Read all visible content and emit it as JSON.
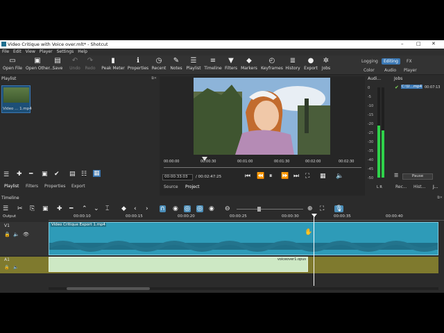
{
  "window": {
    "title": "Video Critique with Voice over.mlt* - Shotcut",
    "controls": [
      "–",
      "□",
      "✕"
    ]
  },
  "menubar": [
    "File",
    "Edit",
    "View",
    "Player",
    "Settings",
    "Help"
  ],
  "toolbar": {
    "buttons": [
      {
        "label": "Open File",
        "icon": "folder-open-icon",
        "glyph": "▭",
        "enabled": true
      },
      {
        "label": "Open Other...",
        "icon": "open-other-icon",
        "glyph": "▣",
        "enabled": true
      },
      {
        "label": "Save",
        "icon": "save-icon",
        "glyph": "▤",
        "enabled": true
      },
      {
        "label": "Undo",
        "icon": "undo-icon",
        "glyph": "↶",
        "enabled": false
      },
      {
        "label": "Redo",
        "icon": "redo-icon",
        "glyph": "↷",
        "enabled": false
      },
      {
        "label": "Peak Meter",
        "icon": "peak-meter-icon",
        "glyph": "▮",
        "enabled": true
      },
      {
        "label": "Properties",
        "icon": "properties-icon",
        "glyph": "ℹ",
        "enabled": true
      },
      {
        "label": "Recent",
        "icon": "recent-icon",
        "glyph": "◷",
        "enabled": true
      },
      {
        "label": "Notes",
        "icon": "notes-icon",
        "glyph": "✎",
        "enabled": true
      },
      {
        "label": "Playlist",
        "icon": "playlist-icon",
        "glyph": "☰",
        "enabled": true
      },
      {
        "label": "Timeline",
        "icon": "timeline-icon",
        "glyph": "≡",
        "enabled": true
      },
      {
        "label": "Filters",
        "icon": "filters-icon",
        "glyph": "▼",
        "enabled": true
      },
      {
        "label": "Markers",
        "icon": "markers-icon",
        "glyph": "◆",
        "enabled": true
      },
      {
        "label": "Keyframes",
        "icon": "keyframes-icon",
        "glyph": "◴",
        "enabled": true
      },
      {
        "label": "History",
        "icon": "history-icon",
        "glyph": "≣",
        "enabled": true
      },
      {
        "label": "Export",
        "icon": "export-icon",
        "glyph": "●",
        "enabled": true
      },
      {
        "label": "Jobs",
        "icon": "jobs-icon",
        "glyph": "✲",
        "enabled": true
      }
    ],
    "layouts": {
      "logging": "Logging",
      "editing": "Editing",
      "fx": "FX",
      "color": "Color",
      "audio": "Audio",
      "player": "Player"
    }
  },
  "playlist": {
    "title": "Playlist",
    "item_label": "Video ... 1.mp4",
    "tabs": [
      "Playlist",
      "Filters",
      "Properties",
      "Export"
    ]
  },
  "player": {
    "current_time": "00:00:33:03",
    "total_time": "/ 00:02:47:25",
    "ruler": [
      "00:00:00",
      "00:00:30",
      "00:01:00",
      "00:01:30",
      "00:02:00",
      "00:02:30"
    ],
    "tabs": [
      "Source",
      "Project"
    ]
  },
  "audio_meter": {
    "title": "Audi...",
    "scale": [
      "0",
      "-5",
      "-10",
      "-15",
      "-20",
      "-25",
      "-30",
      "-35",
      "-40",
      "-45",
      "-50"
    ],
    "channels": "L R",
    "level_left": 0.58,
    "level_right": 0.52
  },
  "jobs": {
    "title": "Jobs",
    "item_name": "C:\\U...mp4",
    "item_time": "00:07:13",
    "pause_label": "Pause",
    "tabs": [
      "Rec...",
      "Hist...",
      "J..."
    ]
  },
  "timeline": {
    "title": "Timeline",
    "output_label": "Output",
    "ruler": [
      "00:00:10",
      "00:00:15",
      "00:00:20",
      "00:00:25",
      "00:00:30",
      "00:00:35",
      "00:00:40"
    ],
    "v1": {
      "name": "V1",
      "clip": "Video Critique Export 1.mp4"
    },
    "a1": {
      "name": "A1",
      "clip": "voiceover1.opus"
    }
  },
  "colors": {
    "video_clip": "#2e9bb8",
    "audio_clip": "#cde8c4",
    "audio_track_bg": "#7f7a2e",
    "accent": "#3b78b4",
    "meter_green": "#2fd24a"
  }
}
